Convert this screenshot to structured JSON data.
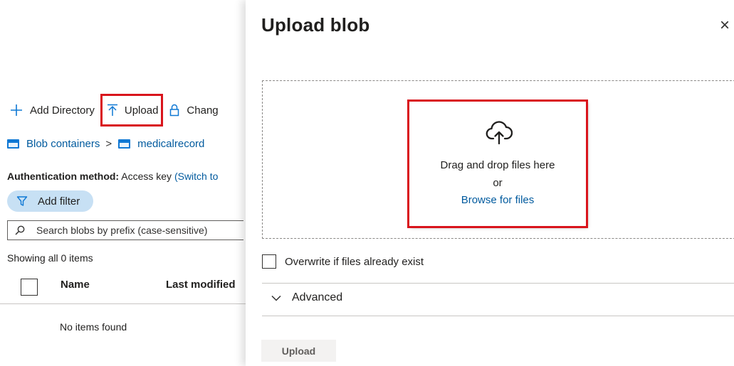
{
  "toolbar": {
    "add_directory": "Add Directory",
    "upload": "Upload",
    "change": "Chang"
  },
  "breadcrumb": {
    "root": "Blob containers",
    "separator": ">",
    "current": "medicalrecord"
  },
  "auth": {
    "label": "Authentication method:",
    "value": "Access key",
    "switch_link": "(Switch to"
  },
  "filter": {
    "label": "Add filter"
  },
  "search": {
    "placeholder": "Search blobs by prefix (case-sensitive)"
  },
  "list": {
    "showing": "Showing all 0 items",
    "columns": [
      "Name",
      "Last modified"
    ],
    "empty": "No items found"
  },
  "panel": {
    "title": "Upload blob",
    "close_glyph": "×",
    "drop_text": "Drag and drop files here",
    "or_text": "or",
    "browse": "Browse for files",
    "overwrite_label": "Overwrite if files already exist",
    "advanced_label": "Advanced",
    "upload_button": "Upload"
  },
  "colors": {
    "accent": "#0078d4",
    "link": "#005a9e",
    "highlight": "#d9141c",
    "pill": "#c7e0f4"
  }
}
